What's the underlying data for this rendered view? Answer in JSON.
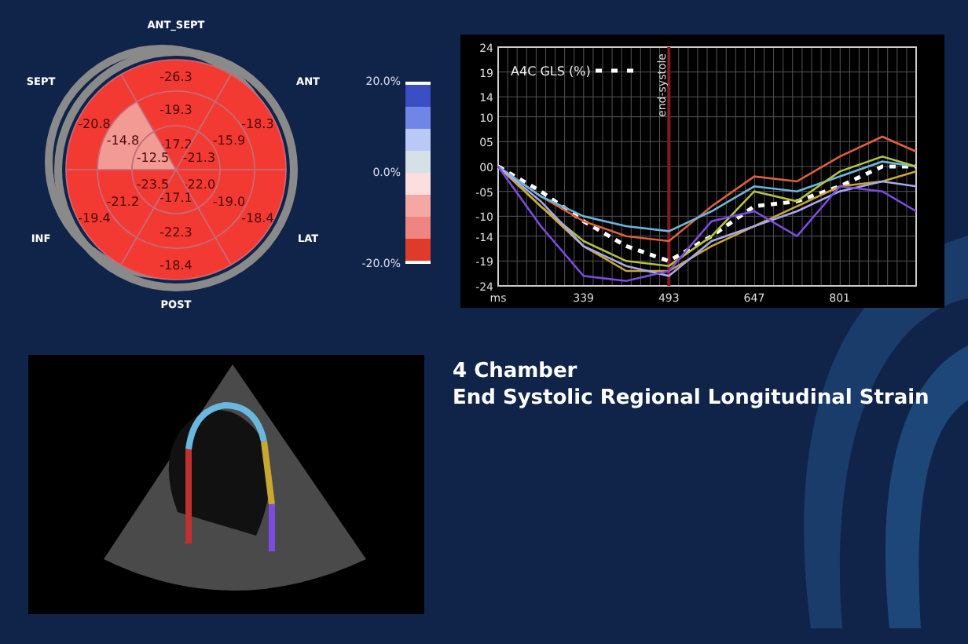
{
  "bullseye": {
    "labels": [
      "ANT_SEPT",
      "ANT",
      "LAT",
      "POST",
      "INF",
      "SEPT"
    ],
    "rings": [
      {
        "segments": [
          {
            "value": "-26.3",
            "color": "#f23a33"
          },
          {
            "value": "-18.3",
            "color": "#f23a33"
          },
          {
            "value": "-18.4",
            "color": "#f23a33"
          },
          {
            "value": "-18.4",
            "color": "#f23a33"
          },
          {
            "value": "-19.4",
            "color": "#f23a33"
          },
          {
            "value": "-20.8",
            "color": "#f23a33"
          }
        ]
      },
      {
        "segments": [
          {
            "value": "-19.3",
            "color": "#f23a33"
          },
          {
            "value": "-15.9",
            "color": "#f23a33"
          },
          {
            "value": "-19.0",
            "color": "#f23a33"
          },
          {
            "value": "-22.3",
            "color": "#f23a33"
          },
          {
            "value": "-21.2",
            "color": "#f23a33"
          },
          {
            "value": "-14.8",
            "color": "#f29a94"
          }
        ]
      },
      {
        "segments": [
          {
            "value": "-17.2",
            "color": "#f23a33"
          },
          {
            "value": "-21.3",
            "color": "#f23a33"
          },
          {
            "value": "-22.0",
            "color": "#f23a33"
          },
          {
            "value": "-17.1",
            "color": "#f23a33"
          },
          {
            "value": "-23.5",
            "color": "#f23a33"
          },
          {
            "value": "-12.5",
            "color": "#f29a94"
          }
        ]
      }
    ]
  },
  "color_scale": {
    "ticks": [
      "20.0%",
      "0.0%",
      "-20.0%"
    ],
    "swatches": [
      {
        "color": "#3a4fc4"
      },
      {
        "color": "#6f86e6"
      },
      {
        "color": "#b9c8f5"
      },
      {
        "color": "#d6e0e8"
      },
      {
        "color": "#fbdedd"
      },
      {
        "color": "#f4a7a3"
      },
      {
        "color": "#ef8580"
      },
      {
        "color": "#e03a2a"
      }
    ]
  },
  "strain_chart": {
    "chart_data": {
      "type": "line",
      "x": [
        185,
        262,
        339,
        416,
        493,
        570,
        647,
        724,
        801,
        878,
        939
      ],
      "xticks": [
        {
          "value": 185,
          "label": "ms"
        },
        339,
        493,
        647,
        801
      ],
      "yticks": [
        {
          "value": 24,
          "label": "24"
        },
        {
          "value": 19,
          "label": "19"
        },
        {
          "value": 14,
          "label": "14"
        },
        {
          "value": 10,
          "label": "10"
        },
        {
          "value": 5,
          "label": "05"
        },
        {
          "value": 0,
          "label": "00"
        },
        {
          "value": -5,
          "label": "-05"
        },
        {
          "value": -10,
          "label": "-10"
        },
        {
          "value": -14,
          "label": "-14"
        },
        {
          "value": -19,
          "label": "-19"
        },
        {
          "value": -24,
          "label": "-24"
        }
      ],
      "ylim": [
        -24,
        24
      ],
      "xlim": [
        185,
        939
      ],
      "grid": true,
      "series": [
        {
          "name": "A4C GLS (%)",
          "color": "#ffffff",
          "line_style": "dashed",
          "values": [
            0,
            -5,
            -11,
            -16,
            -19,
            -14,
            -8,
            -7,
            -4,
            0,
            0
          ]
        },
        {
          "color": "#e0603a",
          "line_style": "solid",
          "values": [
            0,
            -6,
            -11,
            -14,
            -15,
            -8,
            -2,
            -3,
            2,
            6,
            3
          ]
        },
        {
          "color": "#6ab8e0",
          "line_style": "solid",
          "values": [
            0,
            -6,
            -10,
            -12,
            -13,
            -9,
            -4,
            -5,
            -2,
            1,
            0
          ]
        },
        {
          "color": "#b5c23a",
          "line_style": "solid",
          "values": [
            0,
            -8,
            -15,
            -19,
            -20,
            -14,
            -5,
            -7,
            -1,
            2,
            0
          ]
        },
        {
          "color": "#c9a832",
          "line_style": "solid",
          "values": [
            0,
            -8,
            -16,
            -21,
            -21,
            -16,
            -12,
            -8,
            -4,
            -3,
            -1
          ]
        },
        {
          "color": "#a8a8f0",
          "line_style": "solid",
          "values": [
            0,
            -7,
            -16,
            -20,
            -22,
            -15,
            -12,
            -9,
            -5,
            -3,
            -4
          ]
        },
        {
          "color": "#7d4be0",
          "line_style": "solid",
          "values": [
            0,
            -12,
            -22,
            -23,
            -21,
            -11,
            -9,
            -14,
            -4,
            -5,
            -9
          ]
        }
      ],
      "annotations": [
        {
          "x": 493,
          "text": "end-systole"
        }
      ]
    }
  },
  "heading": {
    "title": "4 Chamber",
    "subtitle": "End Systolic Regional Longitudinal Strain"
  }
}
